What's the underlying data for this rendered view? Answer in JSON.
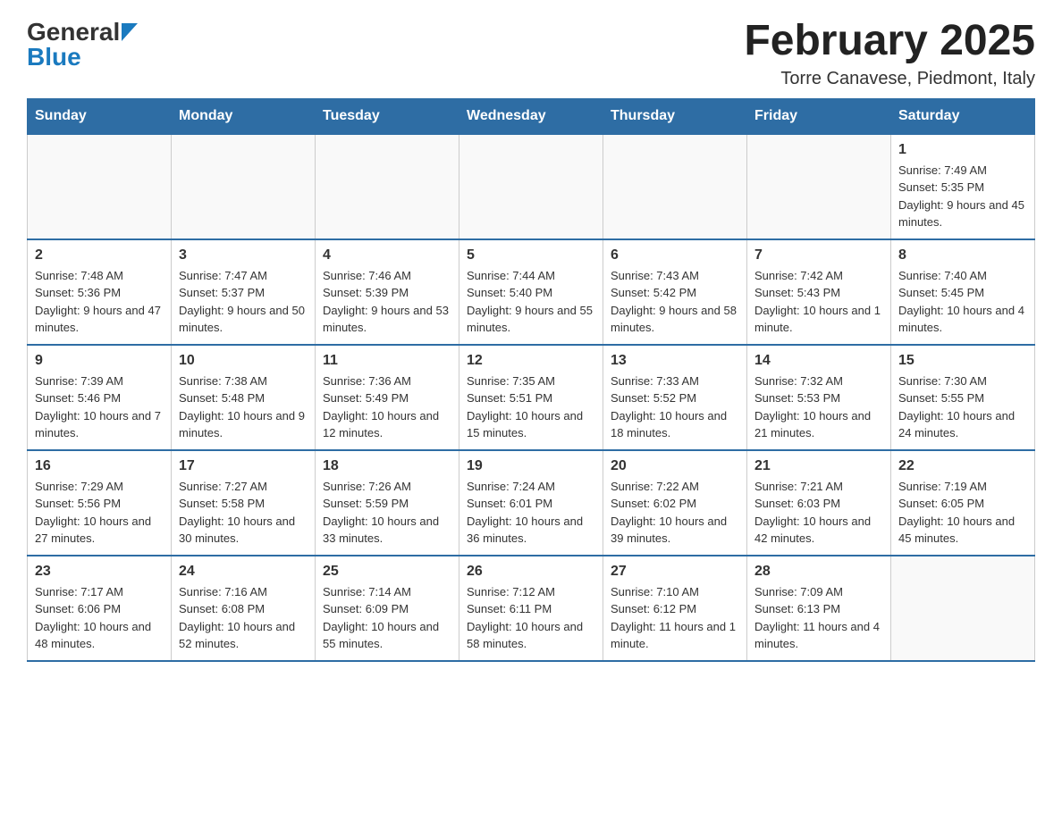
{
  "header": {
    "logo_general": "General",
    "logo_blue": "Blue",
    "title": "February 2025",
    "subtitle": "Torre Canavese, Piedmont, Italy"
  },
  "days_of_week": [
    "Sunday",
    "Monday",
    "Tuesday",
    "Wednesday",
    "Thursday",
    "Friday",
    "Saturday"
  ],
  "weeks": [
    [
      {
        "day": "",
        "info": ""
      },
      {
        "day": "",
        "info": ""
      },
      {
        "day": "",
        "info": ""
      },
      {
        "day": "",
        "info": ""
      },
      {
        "day": "",
        "info": ""
      },
      {
        "day": "",
        "info": ""
      },
      {
        "day": "1",
        "info": "Sunrise: 7:49 AM\nSunset: 5:35 PM\nDaylight: 9 hours and 45 minutes."
      }
    ],
    [
      {
        "day": "2",
        "info": "Sunrise: 7:48 AM\nSunset: 5:36 PM\nDaylight: 9 hours and 47 minutes."
      },
      {
        "day": "3",
        "info": "Sunrise: 7:47 AM\nSunset: 5:37 PM\nDaylight: 9 hours and 50 minutes."
      },
      {
        "day": "4",
        "info": "Sunrise: 7:46 AM\nSunset: 5:39 PM\nDaylight: 9 hours and 53 minutes."
      },
      {
        "day": "5",
        "info": "Sunrise: 7:44 AM\nSunset: 5:40 PM\nDaylight: 9 hours and 55 minutes."
      },
      {
        "day": "6",
        "info": "Sunrise: 7:43 AM\nSunset: 5:42 PM\nDaylight: 9 hours and 58 minutes."
      },
      {
        "day": "7",
        "info": "Sunrise: 7:42 AM\nSunset: 5:43 PM\nDaylight: 10 hours and 1 minute."
      },
      {
        "day": "8",
        "info": "Sunrise: 7:40 AM\nSunset: 5:45 PM\nDaylight: 10 hours and 4 minutes."
      }
    ],
    [
      {
        "day": "9",
        "info": "Sunrise: 7:39 AM\nSunset: 5:46 PM\nDaylight: 10 hours and 7 minutes."
      },
      {
        "day": "10",
        "info": "Sunrise: 7:38 AM\nSunset: 5:48 PM\nDaylight: 10 hours and 9 minutes."
      },
      {
        "day": "11",
        "info": "Sunrise: 7:36 AM\nSunset: 5:49 PM\nDaylight: 10 hours and 12 minutes."
      },
      {
        "day": "12",
        "info": "Sunrise: 7:35 AM\nSunset: 5:51 PM\nDaylight: 10 hours and 15 minutes."
      },
      {
        "day": "13",
        "info": "Sunrise: 7:33 AM\nSunset: 5:52 PM\nDaylight: 10 hours and 18 minutes."
      },
      {
        "day": "14",
        "info": "Sunrise: 7:32 AM\nSunset: 5:53 PM\nDaylight: 10 hours and 21 minutes."
      },
      {
        "day": "15",
        "info": "Sunrise: 7:30 AM\nSunset: 5:55 PM\nDaylight: 10 hours and 24 minutes."
      }
    ],
    [
      {
        "day": "16",
        "info": "Sunrise: 7:29 AM\nSunset: 5:56 PM\nDaylight: 10 hours and 27 minutes."
      },
      {
        "day": "17",
        "info": "Sunrise: 7:27 AM\nSunset: 5:58 PM\nDaylight: 10 hours and 30 minutes."
      },
      {
        "day": "18",
        "info": "Sunrise: 7:26 AM\nSunset: 5:59 PM\nDaylight: 10 hours and 33 minutes."
      },
      {
        "day": "19",
        "info": "Sunrise: 7:24 AM\nSunset: 6:01 PM\nDaylight: 10 hours and 36 minutes."
      },
      {
        "day": "20",
        "info": "Sunrise: 7:22 AM\nSunset: 6:02 PM\nDaylight: 10 hours and 39 minutes."
      },
      {
        "day": "21",
        "info": "Sunrise: 7:21 AM\nSunset: 6:03 PM\nDaylight: 10 hours and 42 minutes."
      },
      {
        "day": "22",
        "info": "Sunrise: 7:19 AM\nSunset: 6:05 PM\nDaylight: 10 hours and 45 minutes."
      }
    ],
    [
      {
        "day": "23",
        "info": "Sunrise: 7:17 AM\nSunset: 6:06 PM\nDaylight: 10 hours and 48 minutes."
      },
      {
        "day": "24",
        "info": "Sunrise: 7:16 AM\nSunset: 6:08 PM\nDaylight: 10 hours and 52 minutes."
      },
      {
        "day": "25",
        "info": "Sunrise: 7:14 AM\nSunset: 6:09 PM\nDaylight: 10 hours and 55 minutes."
      },
      {
        "day": "26",
        "info": "Sunrise: 7:12 AM\nSunset: 6:11 PM\nDaylight: 10 hours and 58 minutes."
      },
      {
        "day": "27",
        "info": "Sunrise: 7:10 AM\nSunset: 6:12 PM\nDaylight: 11 hours and 1 minute."
      },
      {
        "day": "28",
        "info": "Sunrise: 7:09 AM\nSunset: 6:13 PM\nDaylight: 11 hours and 4 minutes."
      },
      {
        "day": "",
        "info": ""
      }
    ]
  ]
}
